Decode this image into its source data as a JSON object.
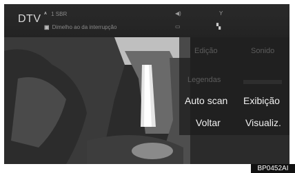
{
  "header": {
    "app_title": "DTV",
    "channel_line1": " 1 SBR",
    "channel_line2": "Dimelho ao da interrupção"
  },
  "menu": {
    "items": [
      {
        "label": "Edição",
        "enabled": false
      },
      {
        "label": "Sonido",
        "enabled": false
      },
      {
        "label": "Legendas",
        "enabled": false
      },
      {
        "label": "Auto scan",
        "enabled": true
      },
      {
        "label": "Exibição",
        "enabled": true
      },
      {
        "label": "Voltar",
        "enabled": true
      },
      {
        "label": "Visualiz.",
        "enabled": true
      }
    ]
  },
  "caption": "BP0452AI",
  "icons": [
    "antenna-icon",
    "speaker-icon",
    "signal-icon",
    "screen-icon",
    "settings-icon"
  ]
}
